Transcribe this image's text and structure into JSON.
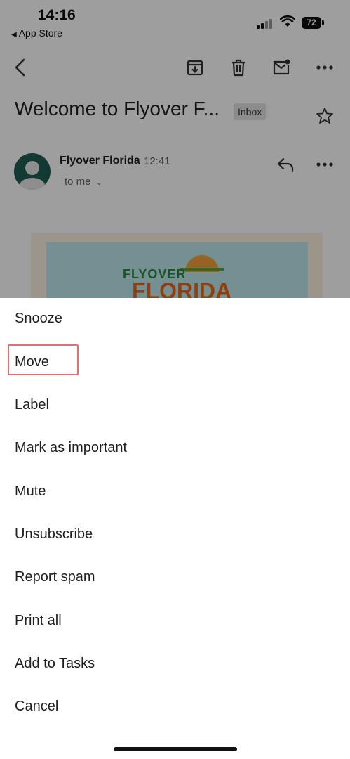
{
  "status_bar": {
    "time": "14:16",
    "back_app": "App Store",
    "battery": "72"
  },
  "toolbar": {
    "icons": [
      "back-arrow-icon",
      "archive-icon",
      "trash-icon",
      "mark-unread-icon",
      "more-icon"
    ]
  },
  "email": {
    "subject": "Welcome to Flyover F...",
    "label": "Inbox",
    "sender_name": "Flyover Florida",
    "time": "12:41",
    "recipient": "to me",
    "logo_line1": "FLYOVER",
    "logo_line2": "FLORIDA"
  },
  "menu": {
    "items": [
      "Snooze",
      "Move",
      "Label",
      "Mark as important",
      "Mute",
      "Unsubscribe",
      "Report spam",
      "Print all",
      "Add to Tasks",
      "Cancel"
    ],
    "highlighted": "Move"
  },
  "colors": {
    "highlight_border": "#e46e6e",
    "avatar_bg": "#1d5d55"
  }
}
